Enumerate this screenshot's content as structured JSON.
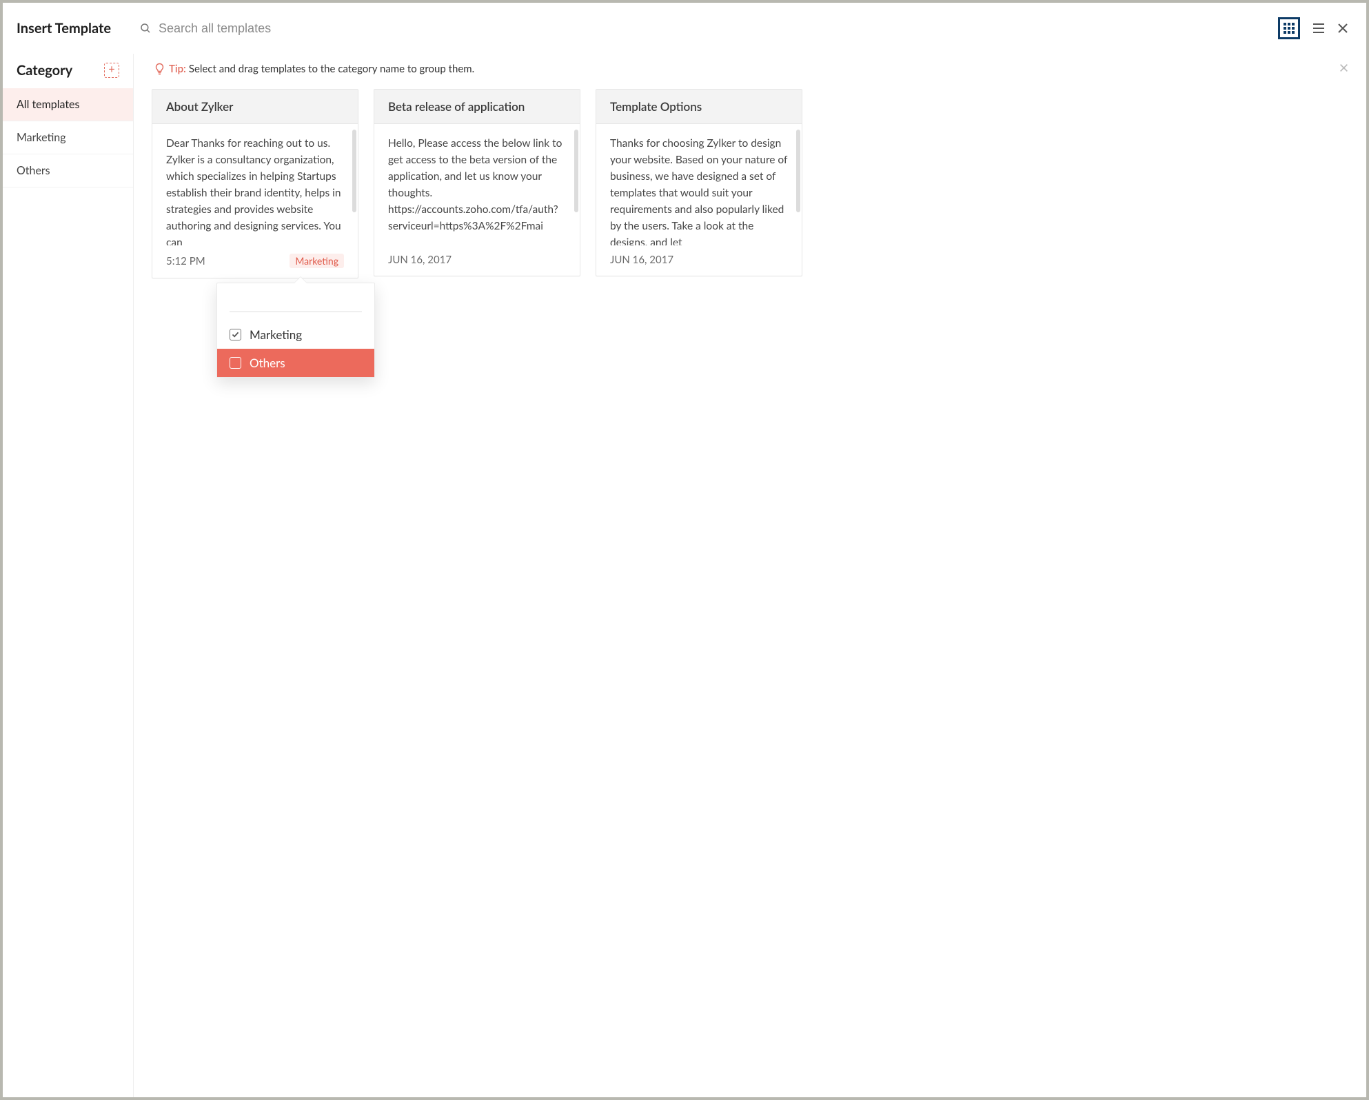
{
  "header": {
    "title": "Insert Template"
  },
  "search": {
    "placeholder": "Search all templates"
  },
  "sidebar": {
    "heading": "Category",
    "items": [
      {
        "label": "All templates",
        "active": true
      },
      {
        "label": "Marketing",
        "active": false
      },
      {
        "label": "Others",
        "active": false
      }
    ]
  },
  "tip": {
    "label": "Tip:",
    "text": "Select and drag templates to the category name to group them."
  },
  "cards": [
    {
      "title": "About Zylker",
      "body": "Dear Thanks for reaching out to us. Zylker is a consultancy organization, which specializes in helping Startups establish their brand identity, helps in strategies and provides website authoring and designing services. You can",
      "time": "5:12 PM",
      "tag": "Marketing",
      "scroll": true
    },
    {
      "title": "Beta release of application",
      "body": "Hello, Please access the below link to get access to the beta version of the application, and let us know your thoughts. https://accounts.zoho.com/tfa/auth?serviceurl=https%3A%2F%2Fmai",
      "time": "JUN 16, 2017",
      "tag": "",
      "scroll": true
    },
    {
      "title": "Template Options",
      "body": "Thanks for choosing Zylker to design your website. Based on your nature of business, we have designed a set of templates that would suit your requirements and also popularly liked by the users. Take a look at the designs, and let",
      "time": "JUN 16, 2017",
      "tag": "",
      "scroll": true
    }
  ],
  "popover": {
    "input_value": "",
    "options": [
      {
        "label": "Marketing",
        "checked": true,
        "hover": false
      },
      {
        "label": "Others",
        "checked": false,
        "hover": true
      }
    ]
  }
}
